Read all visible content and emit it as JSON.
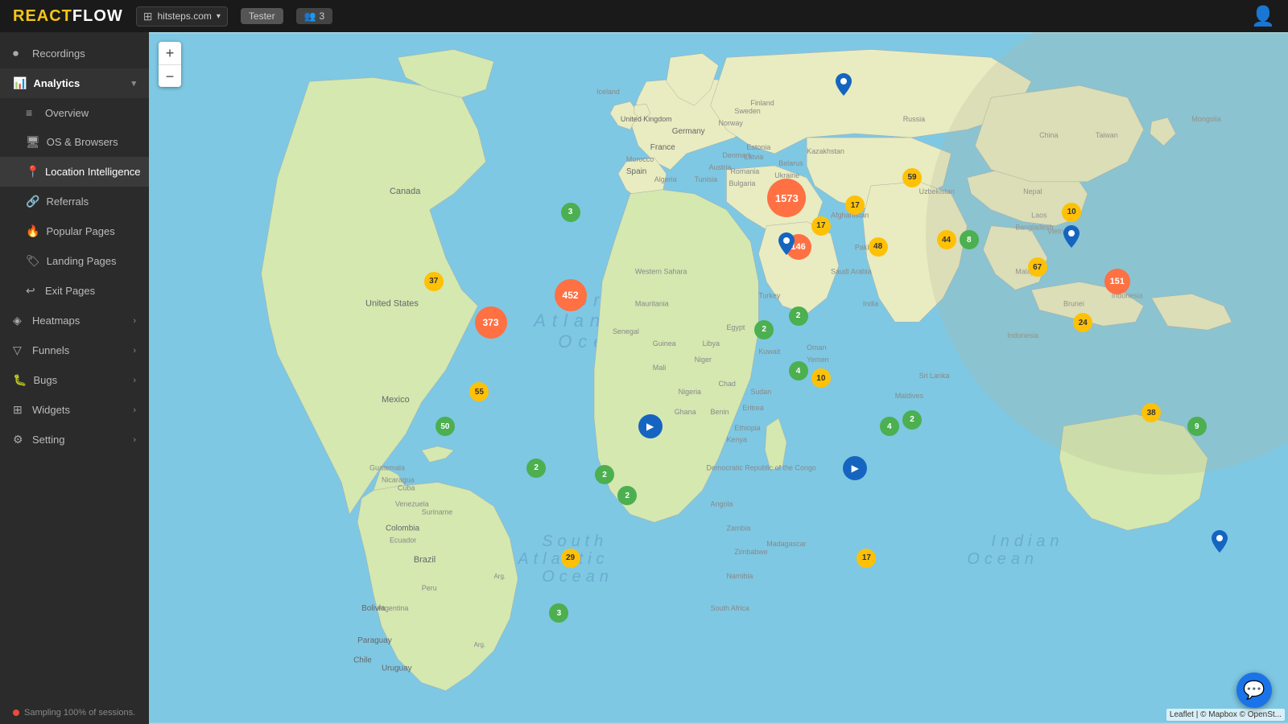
{
  "header": {
    "logo_react": "REACT",
    "logo_flow": "FLOW",
    "site": "hitsteps.com",
    "user": "Tester",
    "users_count": "3",
    "users_icon": "👥"
  },
  "sidebar": {
    "recordings_label": "Recordings",
    "analytics_label": "Analytics",
    "overview_label": "Overview",
    "os_browsers_label": "OS & Browsers",
    "location_intelligence_label": "Location Intelligence",
    "referrals_label": "Referrals",
    "popular_pages_label": "Popular Pages",
    "landing_pages_label": "Landing Pages",
    "exit_pages_label": "Exit Pages",
    "heatmaps_label": "Heatmaps",
    "funnels_label": "Funnels",
    "bugs_label": "Bugs",
    "widgets_label": "Widgets",
    "setting_label": "Setting",
    "sampling_label": "Sampling 100% of sessions."
  },
  "map": {
    "zoom_in": "+",
    "zoom_out": "−",
    "attribution": "Leaflet | © Mapbox © OpenSt...",
    "markers": [
      {
        "id": "us",
        "label": "373",
        "size": "lg",
        "color": "orange",
        "top": "42",
        "left": "30"
      },
      {
        "id": "us2",
        "label": "452",
        "size": "lg",
        "color": "orange",
        "top": "38",
        "left": "37"
      },
      {
        "id": "us3",
        "label": "37",
        "size": "sm",
        "color": "yellow",
        "top": "36",
        "left": "25"
      },
      {
        "id": "canada",
        "label": "3",
        "size": "sm",
        "color": "green",
        "top": "26",
        "left": "37"
      },
      {
        "id": "mexico",
        "label": "55",
        "size": "sm",
        "color": "yellow",
        "top": "52",
        "left": "29"
      },
      {
        "id": "mexico2",
        "label": "50",
        "size": "sm",
        "color": "green",
        "top": "57",
        "left": "26"
      },
      {
        "id": "colombia",
        "label": "2",
        "size": "sm",
        "color": "green",
        "top": "63",
        "left": "34"
      },
      {
        "id": "brazil",
        "label": "2",
        "size": "sm",
        "color": "green",
        "top": "67",
        "left": "42"
      },
      {
        "id": "brazil2",
        "label": "2",
        "size": "sm",
        "color": "green",
        "top": "64",
        "left": "40"
      },
      {
        "id": "chile",
        "label": "29",
        "size": "sm",
        "color": "yellow",
        "top": "76",
        "left": "37"
      },
      {
        "id": "argentina",
        "label": "3",
        "size": "sm",
        "color": "green",
        "top": "84",
        "left": "36"
      },
      {
        "id": "uk",
        "label": "1573",
        "size": "xl",
        "color": "orange",
        "top": "24",
        "left": "56"
      },
      {
        "id": "france",
        "label": "17",
        "size": "sm",
        "color": "yellow",
        "top": "28",
        "left": "59"
      },
      {
        "id": "spain",
        "label": "146",
        "size": "md",
        "color": "orange",
        "top": "31",
        "left": "57"
      },
      {
        "id": "germany",
        "label": "17",
        "size": "sm",
        "color": "yellow",
        "top": "25",
        "left": "62"
      },
      {
        "id": "greece",
        "label": "48",
        "size": "sm",
        "color": "yellow",
        "top": "31",
        "left": "64"
      },
      {
        "id": "ukraine",
        "label": "59",
        "size": "sm",
        "color": "yellow",
        "top": "21",
        "left": "67"
      },
      {
        "id": "russia",
        "label": "8",
        "size": "sm",
        "color": "green",
        "top": "30",
        "left": "72"
      },
      {
        "id": "turkey",
        "label": "44",
        "size": "sm",
        "color": "yellow",
        "top": "30",
        "left": "70"
      },
      {
        "id": "pakistan",
        "label": "67",
        "size": "sm",
        "color": "yellow",
        "top": "34",
        "left": "78"
      },
      {
        "id": "india",
        "label": "151",
        "size": "md",
        "color": "orange",
        "top": "36",
        "left": "85"
      },
      {
        "id": "china",
        "label": "10",
        "size": "sm",
        "color": "yellow",
        "top": "26",
        "left": "81"
      },
      {
        "id": "srilanka",
        "label": "24",
        "size": "sm",
        "color": "yellow",
        "top": "42",
        "left": "82"
      },
      {
        "id": "malaysia",
        "label": "38",
        "size": "sm",
        "color": "yellow",
        "top": "55",
        "left": "88"
      },
      {
        "id": "indonesia",
        "label": "9",
        "size": "sm",
        "color": "green",
        "top": "57",
        "left": "92"
      },
      {
        "id": "kenya",
        "label": "2",
        "size": "sm",
        "color": "green",
        "top": "56",
        "left": "67"
      },
      {
        "id": "congo",
        "label": "4",
        "size": "sm",
        "color": "green",
        "top": "57",
        "left": "65"
      },
      {
        "id": "africa_s",
        "label": "17",
        "size": "sm",
        "color": "yellow",
        "top": "76",
        "left": "63"
      },
      {
        "id": "nigeria",
        "label": "10",
        "size": "sm",
        "color": "yellow",
        "top": "50",
        "left": "59"
      },
      {
        "id": "mauritania",
        "label": "2",
        "size": "sm",
        "color": "green",
        "top": "41",
        "left": "57"
      },
      {
        "id": "senegal",
        "label": "2",
        "size": "sm",
        "color": "green",
        "top": "43",
        "left": "54"
      },
      {
        "id": "ghana",
        "label": "4",
        "size": "sm",
        "color": "green",
        "top": "49",
        "left": "57"
      }
    ],
    "blue_pins": [
      {
        "id": "russia_pin",
        "top": "10",
        "left": "61"
      },
      {
        "id": "morocco_pin",
        "top": "33",
        "left": "56"
      },
      {
        "id": "india_pin2",
        "top": "32",
        "left": "81"
      },
      {
        "id": "australia_pin",
        "top": "76",
        "left": "94"
      }
    ],
    "play_markers": [
      {
        "id": "caribbean_play",
        "top": "57",
        "left": "44"
      },
      {
        "id": "africa_play",
        "top": "63",
        "left": "62"
      }
    ]
  }
}
